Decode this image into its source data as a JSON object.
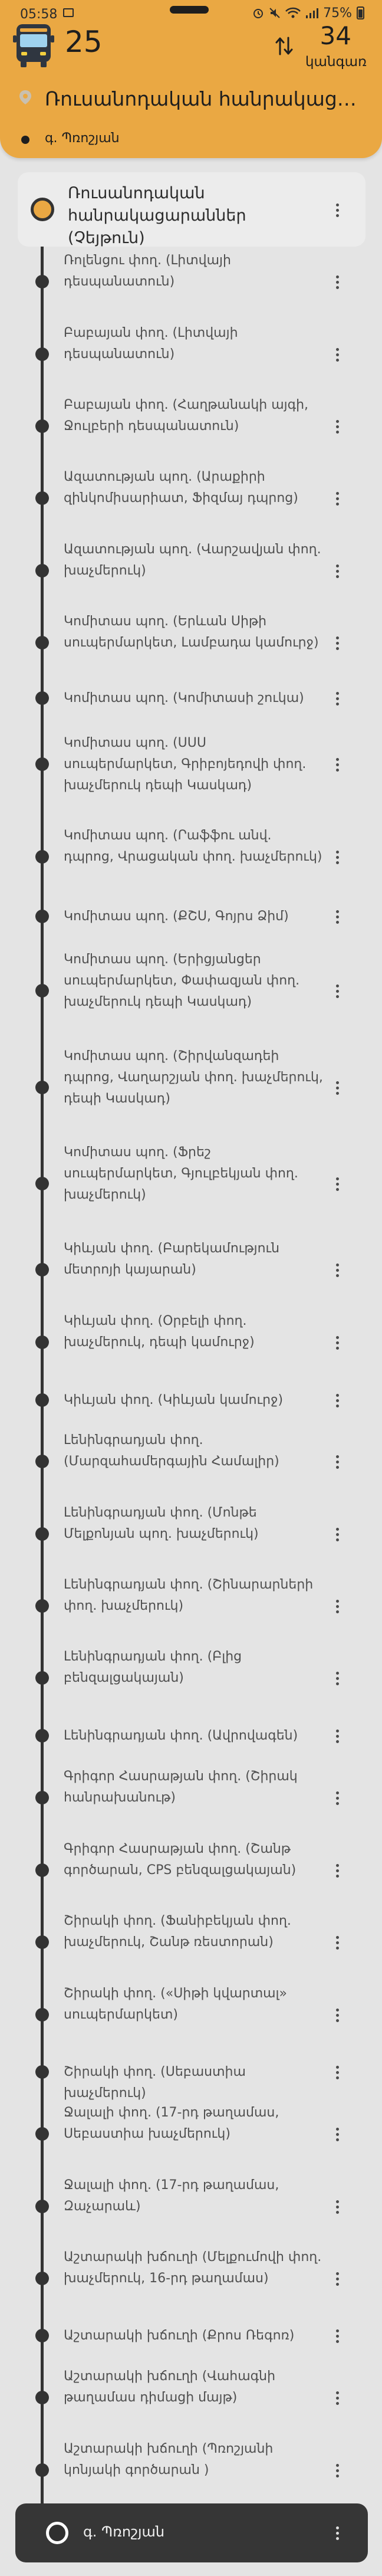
{
  "status_bar": {
    "time": "05:58",
    "battery": "75%",
    "icons": [
      "image-icon",
      "alarm-icon",
      "mute-icon",
      "wifi-icon",
      "signal-icon",
      "battery-icon"
    ]
  },
  "header": {
    "route_number": "25",
    "stop_count": "34",
    "stop_count_label": "կանգառ",
    "route_title": "Ռուսանոդական հանրակացարաններ (Չեյթուն)",
    "destination": "գ. Պռոշյան",
    "accent_color": "#eaa843"
  },
  "stops": [
    "Ռուսանոդական հանրակացարաններ (Չեյթուն)",
    "Ռոլենցու փող. (Լիտվայի դեսպանատուն)",
    "Բաբայան փող. (Լիտվայի դեսպանատուն)",
    "Բաբայան փող. (Հաղթանակի այգի, Ջուլբերի դեսպանատուն)",
    "Ազատության պող. (Արաքիրի զինկոմիսարիատ, Ֆիզմայ դպրոց)",
    "Ազատության պող. (Վարշավյան փող. խաչմերուկ)",
    "Կոմիտաս պող. (Երևան Սիթի սուպերմարկետ, Լամբադա կամուրջ)",
    "Կոմիտաս պող. (Կոմիտասի շուկա)",
    "Կոմիտաս պող. (ՍՍՍ սուպերմարկետ, Գրիբոյեդովի փող. խաչմերուկ դեպի Կասկադ)",
    "Կոմիտաս պող. (Րաֆֆու անվ. դպրոց, Վրացական փող. խաչմերուկ)",
    "Կոմիտաս պող. (ՔՇՍ, Գոյրս Ձիմ)",
    "Կոմիտաս պող. (Երիցյանցեր սուպերմարկետ, Փափազյան փող. խաչմերուկ դեպի Կասկադ)",
    "Կոմիտաս պող. (Շիրվանզադեի դպրոց, Վաղարշյան փող. խաչմերուկ, դեպի Կասկադ)",
    "Կոմիտաս պող. (Ֆրեշ սուպերմարկետ, Գյուլբեկյան փող. խաչմերուկ)",
    "Կիևյան փող. (Բարեկամություն մետրոյի կայարան)",
    "Կիևյան փող. (Օրբելի փող. խաչմերուկ, դեպի կամուրջ)",
    "Կիևյան փող. (Կիևյան կամուրջ)",
    "Լենինգրադյան փող. (Մարզահամերգային Համալիր)",
    "Լենինգրադյան փող. (Մոնթե Մելքոնյան պող. խաչմերուկ)",
    "Լենինգրադյան փող. (Շինարարների փող. խաչմերուկ)",
    "Լենինգրադյան փող. (Բլից բենզալցակայան)",
    "Լենինգրադյան փող. (Ավրովագեն)",
    "Գրիգոր Հասրաթյան փող. (Շիրակ հանրախանութ)",
    "Գրիգոր Հասրաթյան փող. (Շանթ գործարան, CPS բենզալցակայան)",
    "Շիրակի փող. (Ֆանիբեկյան փող. խաչմերուկ, Շանթ ռեստորան)",
    "Շիրակի փող. («Սիթի կվարտալ» սուպերմարկետ)",
    "Շիրակի փող. (Սեբաստիա խաչմերուկ)",
    "Ջալալի փող. (17-րդ թաղամաս, Սեբաստիա խաչմերուկ)",
    "Ջալալի փող. (17-րդ թաղամաս, Զաչարաև)",
    "Աշտարակի խճուղի (Մելքումովի փող. խաչմերուկ, 16-րդ թաղամաս)",
    "Աշտարակի խճուղի (Քրոս Ռեգոռ)",
    "Աշտարակի խճուղի (Վահագնի թաղամաս դիմացի մայթ)",
    "Աշտարակի խճուղի (Պռոշյանի կոնյակի գործարան )",
    "գ. Պռոշյան"
  ]
}
